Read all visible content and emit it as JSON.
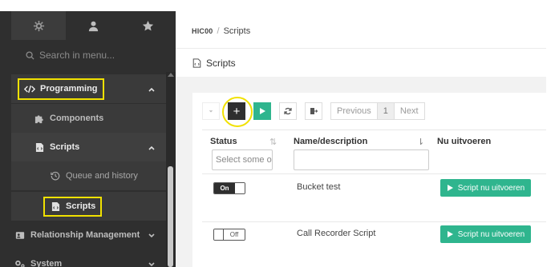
{
  "sidebar": {
    "tabs": [
      {
        "icon": "gear-icon"
      },
      {
        "icon": "user-icon"
      },
      {
        "icon": "star-icon"
      }
    ],
    "search_placeholder": "Search in menu...",
    "items": {
      "programming": "Programming",
      "components": "Components",
      "scripts_group": "Scripts",
      "queue": "Queue and history",
      "scripts_leaf": "Scripts",
      "relationship": "Relationship Management",
      "system": "System"
    },
    "highlight_color": "#f1e100"
  },
  "breadcrumb": {
    "root": "HIC00",
    "separator": "/",
    "current": "Scripts"
  },
  "page": {
    "title": "Scripts"
  },
  "toolbar": {
    "add_label": "+",
    "pager": {
      "previous": "Previous",
      "page": "1",
      "next": "Next"
    }
  },
  "table": {
    "columns": {
      "status": "Status",
      "name": "Name/description",
      "run": "Nu uitvoeren"
    },
    "filters": {
      "status_placeholder": "Select some op"
    },
    "rows": [
      {
        "toggle": "On",
        "name": "Bucket test",
        "action": "Script nu uitvoeren"
      },
      {
        "toggle": "Off",
        "name": "Call Recorder Script",
        "action": "Script nu uitvoeren"
      }
    ]
  },
  "colors": {
    "sidebar_bg": "#2f2f2f",
    "accent_green": "#2fb58e",
    "dark_button": "#2f2f2f"
  }
}
